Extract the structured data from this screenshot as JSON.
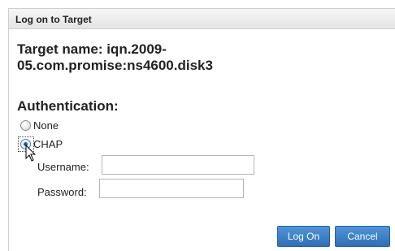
{
  "dialog": {
    "title": "Log on to Target",
    "target_name_line1": "Target name: iqn.2009-",
    "target_name_line2": "05.com.promise:ns4600.disk3"
  },
  "authentication": {
    "heading": "Authentication:",
    "options": [
      {
        "label": "None",
        "selected": false
      },
      {
        "label": "CHAP",
        "selected": true
      }
    ],
    "username_label": "Username:",
    "username_value": "",
    "password_label": "Password:",
    "password_value": ""
  },
  "buttons": {
    "log_on": "Log On",
    "cancel": "Cancel"
  },
  "colors": {
    "button_blue": "#3a7fc6",
    "border_gray": "#cfcfcf"
  }
}
